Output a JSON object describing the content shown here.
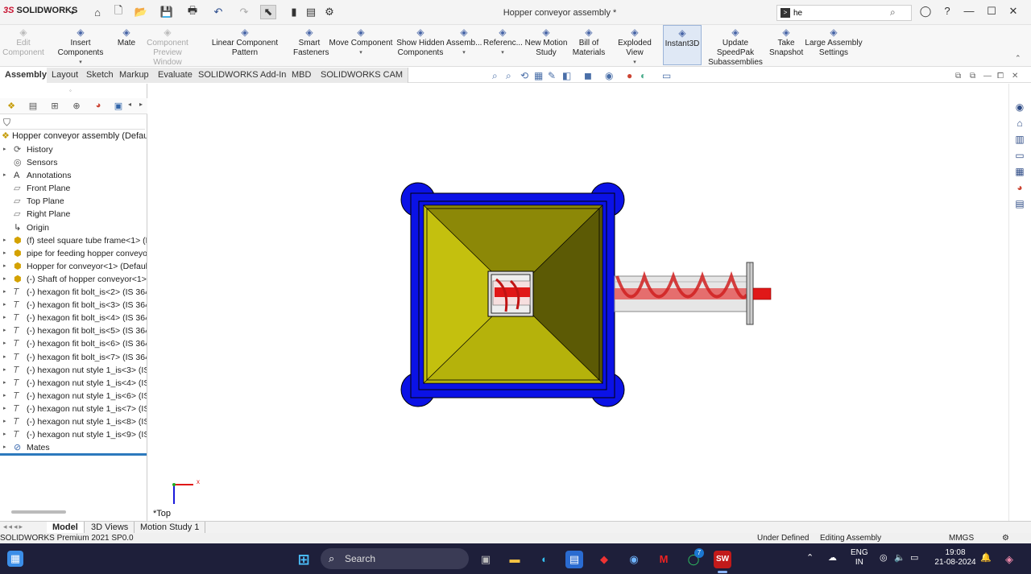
{
  "window": {
    "brand": "SOLIDWORKS",
    "title": "Hopper conveyor assembly *",
    "search_value": "he"
  },
  "command_manager": {
    "items": [
      {
        "label": "Edit\nComponent",
        "icon": "edit-component-icon",
        "disabled": true
      },
      {
        "label": "Insert Components",
        "icon": "insert-components-icon"
      },
      {
        "label": "Mate",
        "icon": "mate-icon"
      },
      {
        "label": "Component\nPreview Window",
        "icon": "preview-window-icon",
        "disabled": true
      },
      {
        "label": "Linear Component Pattern",
        "icon": "linear-pattern-icon"
      },
      {
        "label": "Smart\nFasteners",
        "icon": "smart-fasteners-icon"
      },
      {
        "label": "Move Component",
        "icon": "move-component-icon"
      },
      {
        "label": "Show Hidden\nComponents",
        "icon": "show-hidden-icon"
      },
      {
        "label": "Assemb...",
        "icon": "assembly-features-icon"
      },
      {
        "label": "Referenc...",
        "icon": "reference-geometry-icon"
      },
      {
        "label": "New Motion\nStudy",
        "icon": "motion-study-icon"
      },
      {
        "label": "Bill of\nMaterials",
        "icon": "bom-icon"
      },
      {
        "label": "Exploded View",
        "icon": "exploded-view-icon"
      },
      {
        "label": "Instant3D",
        "icon": "instant3d-icon"
      },
      {
        "label": "Update SpeedPak\nSubassemblies",
        "icon": "speedpak-icon"
      },
      {
        "label": "Take\nSnapshot",
        "icon": "snapshot-icon"
      },
      {
        "label": "Large Assembly\nSettings",
        "icon": "large-assembly-icon"
      }
    ]
  },
  "tabs": [
    "Assembly",
    "Layout",
    "Sketch",
    "Markup",
    "Evaluate",
    "SOLIDWORKS Add-Ins",
    "MBD",
    "SOLIDWORKS CAM"
  ],
  "tree": {
    "root": "Hopper conveyor assembly  (Default",
    "items": [
      {
        "label": "History",
        "icon": "history-icon",
        "exp": true
      },
      {
        "label": "Sensors",
        "icon": "sensors-icon",
        "exp": false
      },
      {
        "label": "Annotations",
        "icon": "annotations-icon",
        "exp": true
      },
      {
        "label": "Front Plane",
        "icon": "plane-icon",
        "exp": false
      },
      {
        "label": "Top Plane",
        "icon": "plane-icon",
        "exp": false
      },
      {
        "label": "Right Plane",
        "icon": "plane-icon",
        "exp": false
      },
      {
        "label": "Origin",
        "icon": "origin-icon",
        "exp": false
      },
      {
        "label": "(f) steel square tube frame<1> (D",
        "icon": "part-icon",
        "exp": true
      },
      {
        "label": "pipe for feeding hopper conveyo",
        "icon": "part-icon",
        "exp": true
      },
      {
        "label": "Hopper for conveyor<1> (Defaul",
        "icon": "part-icon",
        "exp": true
      },
      {
        "label": "(-) Shaft of hopper conveyor<1>",
        "icon": "part-icon",
        "exp": true
      },
      {
        "label": "(-) hexagon fit bolt_is<2> (IS 364",
        "icon": "bolt-icon",
        "exp": true
      },
      {
        "label": "(-) hexagon fit bolt_is<3> (IS 364",
        "icon": "bolt-icon",
        "exp": true
      },
      {
        "label": "(-) hexagon fit bolt_is<4> (IS 364",
        "icon": "bolt-icon",
        "exp": true
      },
      {
        "label": "(-) hexagon fit bolt_is<5> (IS 364",
        "icon": "bolt-icon",
        "exp": true
      },
      {
        "label": "(-) hexagon fit bolt_is<6> (IS 364",
        "icon": "bolt-icon",
        "exp": true
      },
      {
        "label": "(-) hexagon fit bolt_is<7> (IS 364",
        "icon": "bolt-icon",
        "exp": true
      },
      {
        "label": "(-) hexagon nut style 1_is<3> (IS",
        "icon": "bolt-icon",
        "exp": true
      },
      {
        "label": "(-) hexagon nut style 1_is<4> (IS",
        "icon": "bolt-icon",
        "exp": true
      },
      {
        "label": "(-) hexagon nut style 1_is<6> (IS",
        "icon": "bolt-icon",
        "exp": true
      },
      {
        "label": "(-) hexagon nut style 1_is<7> (IS",
        "icon": "bolt-icon",
        "exp": true
      },
      {
        "label": "(-) hexagon nut style 1_is<8> (IS",
        "icon": "bolt-icon",
        "exp": true
      },
      {
        "label": "(-) hexagon nut style 1_is<9> (IS",
        "icon": "bolt-icon",
        "exp": true
      },
      {
        "label": "Mates",
        "icon": "mates-icon",
        "exp": true
      }
    ]
  },
  "viewport": {
    "view_name": "*Top",
    "triad_x": "x",
    "colors": {
      "frame": "#0b12e6",
      "hopper": "#b4b20a",
      "shaft": "#e01818"
    }
  },
  "bottom_tabs": [
    "Model",
    "3D Views",
    "Motion Study 1"
  ],
  "status": {
    "product": "SOLIDWORKS Premium 2021 SP0.0",
    "state": "Under Defined",
    "mode": "Editing Assembly",
    "units": "MMGS"
  },
  "taskbar": {
    "search": "Search",
    "lang": "ENG",
    "region": "IN",
    "time": "19:08",
    "date": "21-08-2024",
    "whatsapp_badge": "7"
  }
}
